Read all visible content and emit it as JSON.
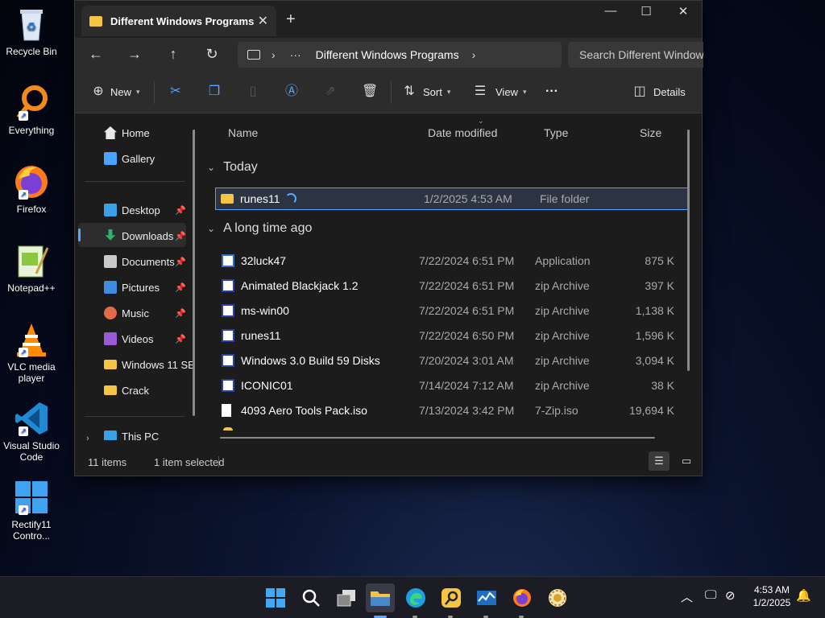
{
  "desktop": {
    "icons": [
      {
        "label": "Recycle Bin",
        "icon": "recycle-bin-icon"
      },
      {
        "label": "Everything",
        "icon": "everything-icon"
      },
      {
        "label": "Firefox",
        "icon": "firefox-icon"
      },
      {
        "label": "Notepad++",
        "icon": "notepad-plus-plus-icon"
      },
      {
        "label": "VLC media player",
        "icon": "vlc-icon"
      },
      {
        "label": "Visual Studio Code",
        "icon": "vscode-icon"
      },
      {
        "label": "Rectify11 Contro...",
        "icon": "rectify11-icon"
      }
    ]
  },
  "window": {
    "tab_title": "Different Windows Programs",
    "address": {
      "breadcrumb": "Different Windows Programs",
      "ellipsis": "···"
    },
    "search_placeholder": "Search Different Windows",
    "toolbar": {
      "new_label": "New",
      "sort_label": "Sort",
      "view_label": "View",
      "more_label": "···",
      "details_label": "Details"
    },
    "nav": {
      "items": [
        {
          "label": "Home",
          "color": "#e8e8e8"
        },
        {
          "label": "Gallery",
          "color": "#4aa3ff"
        },
        {
          "label": "Desktop",
          "color": "#3aa0e8",
          "pinned": true
        },
        {
          "label": "Downloads",
          "color": "#2fb36a",
          "pinned": true
        },
        {
          "label": "Documents",
          "color": "#c9c9c9",
          "pinned": true
        },
        {
          "label": "Pictures",
          "color": "#3f8de0",
          "pinned": true
        },
        {
          "label": "Music",
          "color": "#e36a4a",
          "pinned": true
        },
        {
          "label": "Videos",
          "color": "#9a5ad6",
          "pinned": true
        },
        {
          "label": "Windows 11 SE",
          "color": "#f5c443"
        },
        {
          "label": "Crack",
          "color": "#f5c443"
        },
        {
          "label": "This PC",
          "color": "#3aa0e8"
        }
      ]
    },
    "columns": {
      "name": "Name",
      "date": "Date modified",
      "type": "Type",
      "size": "Size"
    },
    "groups": {
      "today": "Today",
      "long_ago": "A long time ago"
    },
    "today_files": [
      {
        "name": "runes11",
        "date": "1/2/2025 4:53 AM",
        "type": "File folder",
        "size": "",
        "icon": "folder-icon"
      }
    ],
    "old_files": [
      {
        "name": "32luck47",
        "date": "7/22/2024 6:51 PM",
        "type": "Application",
        "size": "875 K",
        "icon": "application-icon"
      },
      {
        "name": "Animated Blackjack 1.2",
        "date": "7/22/2024 6:51 PM",
        "type": "zip Archive",
        "size": "397 K",
        "icon": "zip-icon"
      },
      {
        "name": "ms-win00",
        "date": "7/22/2024 6:51 PM",
        "type": "zip Archive",
        "size": "1,138 K",
        "icon": "zip-icon"
      },
      {
        "name": "runes11",
        "date": "7/22/2024 6:50 PM",
        "type": "zip Archive",
        "size": "1,596 K",
        "icon": "zip-icon"
      },
      {
        "name": "Windows 3.0 Build 59 Disks",
        "date": "7/20/2024 3:01 AM",
        "type": "zip Archive",
        "size": "3,094 K",
        "icon": "zip-icon"
      },
      {
        "name": "ICONIC01",
        "date": "7/14/2024 7:12 AM",
        "type": "zip Archive",
        "size": "38 K",
        "icon": "zip-icon"
      },
      {
        "name": "4093 Aero Tools Pack.iso",
        "date": "7/13/2024 3:42 PM",
        "type": "7-Zip.iso",
        "size": "19,694 K",
        "icon": "iso-file-icon"
      }
    ],
    "status": {
      "count": "11 items",
      "selected": "1 item selected"
    }
  },
  "taskbar": {
    "apps": [
      "start-icon",
      "search-icon",
      "task-view-icon",
      "file-explorer-icon",
      "edge-icon",
      "everything-icon",
      "task-manager-icon",
      "firefox-icon",
      "app-icon"
    ],
    "time": "4:53 AM",
    "date": "1/2/2025"
  },
  "colors": {
    "accent": "#59a6ff",
    "folder": "#f5c443",
    "selection_border": "#4aa3ff"
  }
}
